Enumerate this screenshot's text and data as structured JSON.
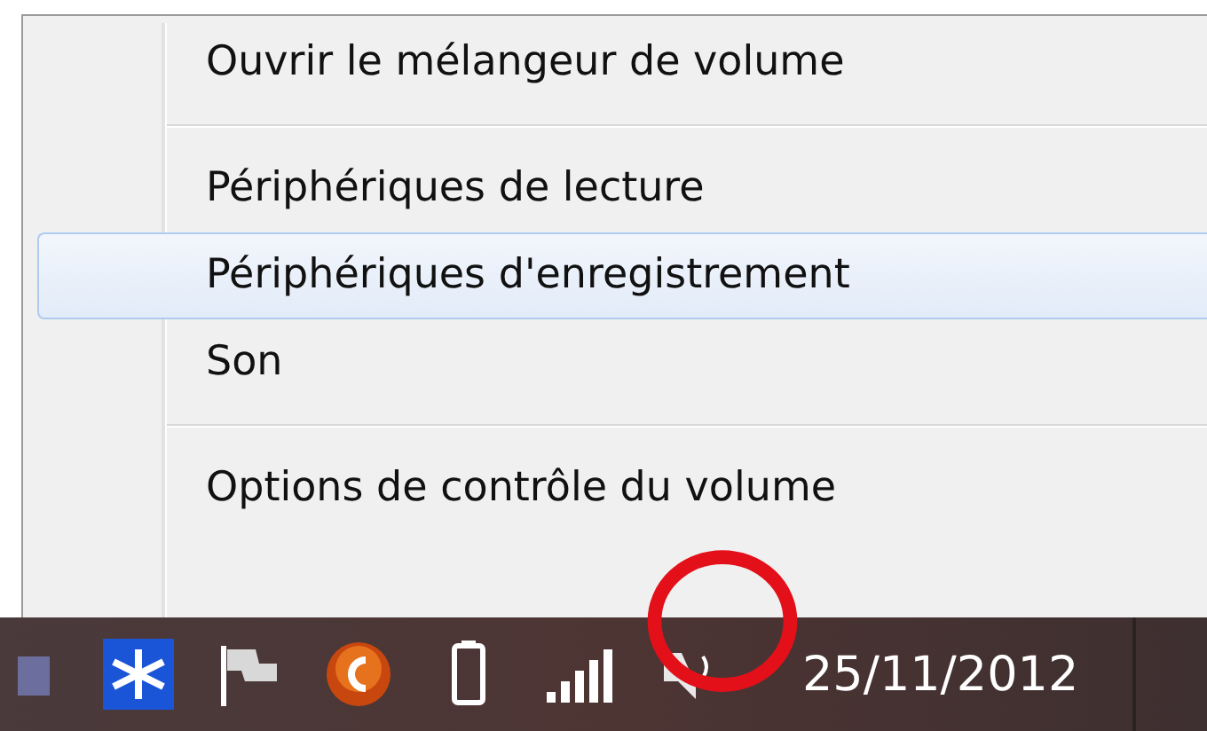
{
  "menu": {
    "items": [
      {
        "kind": "item",
        "label": "Ouvrir le mélangeur de volume",
        "selected": false
      },
      {
        "kind": "separator"
      },
      {
        "kind": "item",
        "label": "Périphériques de lecture",
        "selected": false
      },
      {
        "kind": "item",
        "label": "Périphériques d'enregistrement",
        "selected": true
      },
      {
        "kind": "item",
        "label": "Son",
        "selected": false
      },
      {
        "kind": "separator"
      },
      {
        "kind": "item",
        "label": "Options de contrôle du volume",
        "selected": false
      }
    ]
  },
  "taskbar": {
    "date": "25/11/2012"
  }
}
